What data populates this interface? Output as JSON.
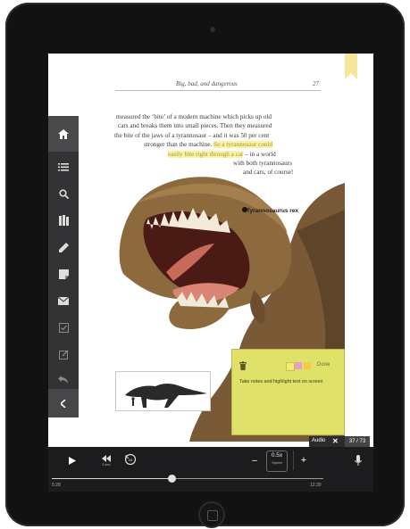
{
  "book": {
    "running_title": "Big, bad, and dangerous",
    "page_number": "27",
    "lines": [
      "measured the ‘bite’ of a modern machine which picks up old",
      "cars and breaks them into small pieces. Then they measured",
      "the bite of the jaws of a tyrannosaur – and it was 50 per cent"
    ],
    "line4_plain": "stronger than the machine. ",
    "line4_highlight": "So a tyrannosaur could",
    "line5_highlight": "easily bite right through a car",
    "line5_plain": " – in a world",
    "line6": "with both tyrannosaurs",
    "line7": "and cars, of course!",
    "caption": "Tyrannosaurus rex"
  },
  "sidebar": {
    "items": [
      "home-icon",
      "contents-list-icon",
      "search-icon",
      "library-icon",
      "pen-icon",
      "sticky-note-icon",
      "mail-icon",
      "checklist-icon",
      "edit-icon",
      "undo-icon",
      "collapse-icon"
    ]
  },
  "note": {
    "delete_icon": "trash-icon",
    "done_label": "Done",
    "text": "Take notes and highlight text on screen",
    "colors": [
      "#f4ec6e",
      "#e6a0cc",
      "#f3c94b"
    ]
  },
  "audio": {
    "label": "Audio",
    "close_label": "✕",
    "page_counter": "37 / 73"
  },
  "player": {
    "speed_value": "0.5x",
    "speed_label": "Speed",
    "minus_label": "–",
    "plus_label": "+",
    "skip_label": "5 sec",
    "rewind_label": "10",
    "time_elapsed": "5:28",
    "time_total": "12:30",
    "progress": 0.44
  },
  "colors": {
    "highlight": "#fbf3a6",
    "note": "#dfe168",
    "bookmark": "#f4e79a",
    "toolbar": "#333335"
  }
}
